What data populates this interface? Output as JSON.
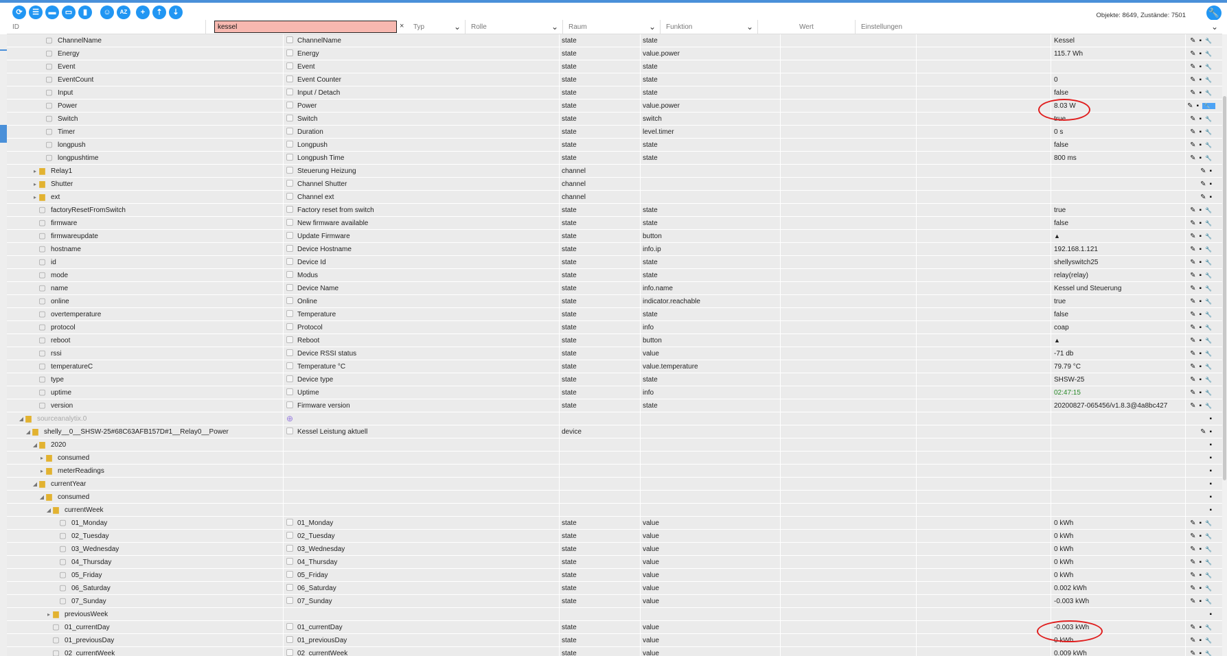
{
  "toolbar": {
    "buttons": [
      {
        "name": "refresh-icon",
        "glyph": "⟳"
      },
      {
        "name": "list-view-icon",
        "glyph": "☰"
      },
      {
        "name": "folder-icon",
        "glyph": "▬"
      },
      {
        "name": "folder-open-icon",
        "glyph": "▭"
      },
      {
        "name": "save-icon",
        "glyph": "▮"
      },
      {
        "name": "user-icon",
        "glyph": "☺"
      },
      {
        "name": "sort-az-icon",
        "glyph": "AZ"
      },
      {
        "name": "add-icon",
        "glyph": "+"
      },
      {
        "name": "upload-icon",
        "glyph": "⇡"
      },
      {
        "name": "download-icon",
        "glyph": "⇣"
      }
    ],
    "stats": "Objekte: 8649, Zustände: 7501"
  },
  "filter": {
    "id_label": "ID",
    "id_value": "kessel",
    "clear": "×",
    "typ": "Typ",
    "rolle": "Rolle",
    "raum": "Raum",
    "funktion": "Funktion",
    "wert": "Wert",
    "einstellungen": "Einstellungen"
  },
  "icons": {
    "edit": "✎",
    "delete": "🗑",
    "settings": "🔧",
    "folder": "▆",
    "file": "▢",
    "expand": "▸",
    "collapse": "◢"
  },
  "rows": [
    {
      "indent": 3,
      "ico": "file",
      "id": "ChannelName",
      "name": "ChannelName",
      "typ": "state",
      "rolle": "state",
      "value": "Kessel",
      "actions": "✎▪🔧"
    },
    {
      "indent": 3,
      "ico": "file",
      "id": "Energy",
      "name": "Energy",
      "typ": "state",
      "rolle": "value.power",
      "value": "115.7 Wh",
      "actions": "✎▪🔧"
    },
    {
      "indent": 3,
      "ico": "file",
      "id": "Event",
      "name": "Event",
      "typ": "state",
      "rolle": "state",
      "value": "",
      "actions": "✎▪🔧"
    },
    {
      "indent": 3,
      "ico": "file",
      "id": "EventCount",
      "name": "Event Counter",
      "typ": "state",
      "rolle": "state",
      "value": "0",
      "actions": "✎▪🔧"
    },
    {
      "indent": 3,
      "ico": "file",
      "id": "Input",
      "name": "Input / Detach",
      "typ": "state",
      "rolle": "state",
      "value": "false",
      "actions": "✎▪🔧"
    },
    {
      "indent": 3,
      "ico": "file",
      "id": "Power",
      "name": "Power",
      "typ": "state",
      "rolle": "value.power",
      "value": "8.03 W",
      "actions": "✎▪🔧",
      "highlight": true
    },
    {
      "indent": 3,
      "ico": "file",
      "id": "Switch",
      "name": "Switch",
      "typ": "state",
      "rolle": "switch",
      "value": "true",
      "actions": "✎▪🔧"
    },
    {
      "indent": 3,
      "ico": "file",
      "id": "Timer",
      "name": "Duration",
      "typ": "state",
      "rolle": "level.timer",
      "value": "0 s",
      "actions": "✎▪🔧"
    },
    {
      "indent": 3,
      "ico": "file",
      "id": "longpush",
      "name": "Longpush",
      "typ": "state",
      "rolle": "state",
      "value": "false",
      "actions": "✎▪🔧"
    },
    {
      "indent": 3,
      "ico": "file",
      "id": "longpushtime",
      "name": "Longpush Time",
      "typ": "state",
      "rolle": "state",
      "value": "800 ms",
      "actions": "✎▪🔧"
    },
    {
      "indent": 2,
      "exp": "▸",
      "ico": "folder",
      "id": "Relay1",
      "name": "Steuerung Heizung",
      "typ": "channel",
      "rolle": "",
      "value": "",
      "actions": "✎▪"
    },
    {
      "indent": 2,
      "exp": "▸",
      "ico": "folder",
      "id": "Shutter",
      "name": "Channel Shutter",
      "typ": "channel",
      "rolle": "",
      "value": "",
      "actions": "✎▪"
    },
    {
      "indent": 2,
      "exp": "▸",
      "ico": "folder",
      "id": "ext",
      "name": "Channel ext",
      "typ": "channel",
      "rolle": "",
      "value": "",
      "actions": "✎▪"
    },
    {
      "indent": 2,
      "ico": "file",
      "id": "factoryResetFromSwitch",
      "name": "Factory reset from switch",
      "typ": "state",
      "rolle": "state",
      "value": "true",
      "actions": "✎▪🔧"
    },
    {
      "indent": 2,
      "ico": "file",
      "id": "firmware",
      "name": "New firmware available",
      "typ": "state",
      "rolle": "state",
      "value": "false",
      "actions": "✎▪🔧"
    },
    {
      "indent": 2,
      "ico": "file",
      "id": "firmwareupdate",
      "name": "Update Firmware",
      "typ": "state",
      "rolle": "button",
      "value": "▲",
      "actions": "✎▪🔧"
    },
    {
      "indent": 2,
      "ico": "file",
      "id": "hostname",
      "name": "Device Hostname",
      "typ": "state",
      "rolle": "info.ip",
      "value": "192.168.1.121",
      "actions": "✎▪🔧"
    },
    {
      "indent": 2,
      "ico": "file",
      "id": "id",
      "name": "Device Id",
      "typ": "state",
      "rolle": "state",
      "value": "shellyswitch25",
      "actions": "✎▪🔧"
    },
    {
      "indent": 2,
      "ico": "file",
      "id": "mode",
      "name": "Modus",
      "typ": "state",
      "rolle": "state",
      "value": "relay(relay)",
      "actions": "✎▪🔧"
    },
    {
      "indent": 2,
      "ico": "file",
      "id": "name",
      "name": "Device Name",
      "typ": "state",
      "rolle": "info.name",
      "value": "Kessel und Steuerung",
      "actions": "✎▪🔧"
    },
    {
      "indent": 2,
      "ico": "file",
      "id": "online",
      "name": "Online",
      "typ": "state",
      "rolle": "indicator.reachable",
      "value": "true",
      "actions": "✎▪🔧"
    },
    {
      "indent": 2,
      "ico": "file",
      "id": "overtemperature",
      "name": "Temperature",
      "typ": "state",
      "rolle": "state",
      "value": "false",
      "actions": "✎▪🔧"
    },
    {
      "indent": 2,
      "ico": "file",
      "id": "protocol",
      "name": "Protocol",
      "typ": "state",
      "rolle": "info",
      "value": "coap",
      "actions": "✎▪🔧"
    },
    {
      "indent": 2,
      "ico": "file",
      "id": "reboot",
      "name": "Reboot",
      "typ": "state",
      "rolle": "button",
      "value": "▲",
      "actions": "✎▪🔧"
    },
    {
      "indent": 2,
      "ico": "file",
      "id": "rssi",
      "name": "Device RSSI status",
      "typ": "state",
      "rolle": "value",
      "value": "-71 db",
      "actions": "✎▪🔧"
    },
    {
      "indent": 2,
      "ico": "file",
      "id": "temperatureC",
      "name": "Temperature °C",
      "typ": "state",
      "rolle": "value.temperature",
      "value": "79.79 °C",
      "actions": "✎▪🔧"
    },
    {
      "indent": 2,
      "ico": "file",
      "id": "type",
      "name": "Device type",
      "typ": "state",
      "rolle": "state",
      "value": "SHSW-25",
      "actions": "✎▪🔧"
    },
    {
      "indent": 2,
      "ico": "file",
      "id": "uptime",
      "name": "Uptime",
      "typ": "state",
      "rolle": "info",
      "value": "02:47:15",
      "actions": "✎▪🔧",
      "green": true
    },
    {
      "indent": 2,
      "ico": "file",
      "id": "version",
      "name": "Firmware version",
      "typ": "state",
      "rolle": "state",
      "value": "20200827-065456/v1.8.3@4a8bc427",
      "actions": "✎▪🔧"
    },
    {
      "indent": 0,
      "exp": "◢",
      "ico": "folder",
      "id": "sourceanalytix.0",
      "name": "⊕",
      "typ": "",
      "rolle": "",
      "value": "",
      "actions": "▪",
      "grey": true
    },
    {
      "indent": 1,
      "exp": "◢",
      "ico": "folder",
      "id": "shelly__0__SHSW-25#68C63AFB157D#1__Relay0__Power",
      "name": "Kessel Leistung aktuell",
      "typ": "device",
      "rolle": "",
      "value": "",
      "actions": "✎▪"
    },
    {
      "indent": 2,
      "exp": "◢",
      "ico": "folder",
      "id": "2020",
      "name": "",
      "typ": "",
      "rolle": "",
      "value": "",
      "actions": "▪",
      "noname": true
    },
    {
      "indent": 3,
      "exp": "▸",
      "ico": "folder",
      "id": "consumed",
      "name": "",
      "typ": "",
      "rolle": "",
      "value": "",
      "actions": "▪",
      "noname": true
    },
    {
      "indent": 3,
      "exp": "▸",
      "ico": "folder",
      "id": "meterReadings",
      "name": "",
      "typ": "",
      "rolle": "",
      "value": "",
      "actions": "▪",
      "noname": true
    },
    {
      "indent": 2,
      "exp": "◢",
      "ico": "folder",
      "id": "currentYear",
      "name": "",
      "typ": "",
      "rolle": "",
      "value": "",
      "actions": "▪",
      "noname": true
    },
    {
      "indent": 3,
      "exp": "◢",
      "ico": "folder",
      "id": "consumed",
      "name": "",
      "typ": "",
      "rolle": "",
      "value": "",
      "actions": "▪",
      "noname": true
    },
    {
      "indent": 4,
      "exp": "◢",
      "ico": "folder",
      "id": "currentWeek",
      "name": "",
      "typ": "",
      "rolle": "",
      "value": "",
      "actions": "▪",
      "noname": true
    },
    {
      "indent": 5,
      "ico": "file",
      "id": "01_Monday",
      "name": "01_Monday",
      "typ": "state",
      "rolle": "value",
      "value": "0 kWh",
      "actions": "✎▪🔧"
    },
    {
      "indent": 5,
      "ico": "file",
      "id": "02_Tuesday",
      "name": "02_Tuesday",
      "typ": "state",
      "rolle": "value",
      "value": "0 kWh",
      "actions": "✎▪🔧"
    },
    {
      "indent": 5,
      "ico": "file",
      "id": "03_Wednesday",
      "name": "03_Wednesday",
      "typ": "state",
      "rolle": "value",
      "value": "0 kWh",
      "actions": "✎▪🔧"
    },
    {
      "indent": 5,
      "ico": "file",
      "id": "04_Thursday",
      "name": "04_Thursday",
      "typ": "state",
      "rolle": "value",
      "value": "0 kWh",
      "actions": "✎▪🔧"
    },
    {
      "indent": 5,
      "ico": "file",
      "id": "05_Friday",
      "name": "05_Friday",
      "typ": "state",
      "rolle": "value",
      "value": "0 kWh",
      "actions": "✎▪🔧"
    },
    {
      "indent": 5,
      "ico": "file",
      "id": "06_Saturday",
      "name": "06_Saturday",
      "typ": "state",
      "rolle": "value",
      "value": "0.002 kWh",
      "actions": "✎▪🔧"
    },
    {
      "indent": 5,
      "ico": "file",
      "id": "07_Sunday",
      "name": "07_Sunday",
      "typ": "state",
      "rolle": "value",
      "value": "-0.003 kWh",
      "actions": "✎▪🔧"
    },
    {
      "indent": 4,
      "exp": "▸",
      "ico": "folder",
      "id": "previousWeek",
      "name": "",
      "typ": "",
      "rolle": "",
      "value": "",
      "actions": "▪",
      "noname": true
    },
    {
      "indent": 4,
      "ico": "file",
      "id": "01_currentDay",
      "name": "01_currentDay",
      "typ": "state",
      "rolle": "value",
      "value": "-0.003 kWh",
      "actions": "✎▪🔧"
    },
    {
      "indent": 4,
      "ico": "file",
      "id": "01_previousDay",
      "name": "01_previousDay",
      "typ": "state",
      "rolle": "value",
      "value": "0 kWh",
      "actions": "✎▪🔧"
    },
    {
      "indent": 4,
      "ico": "file",
      "id": "02_currentWeek",
      "name": "02_currentWeek",
      "typ": "state",
      "rolle": "value",
      "value": "0.009 kWh",
      "actions": "✎▪🔧"
    }
  ]
}
